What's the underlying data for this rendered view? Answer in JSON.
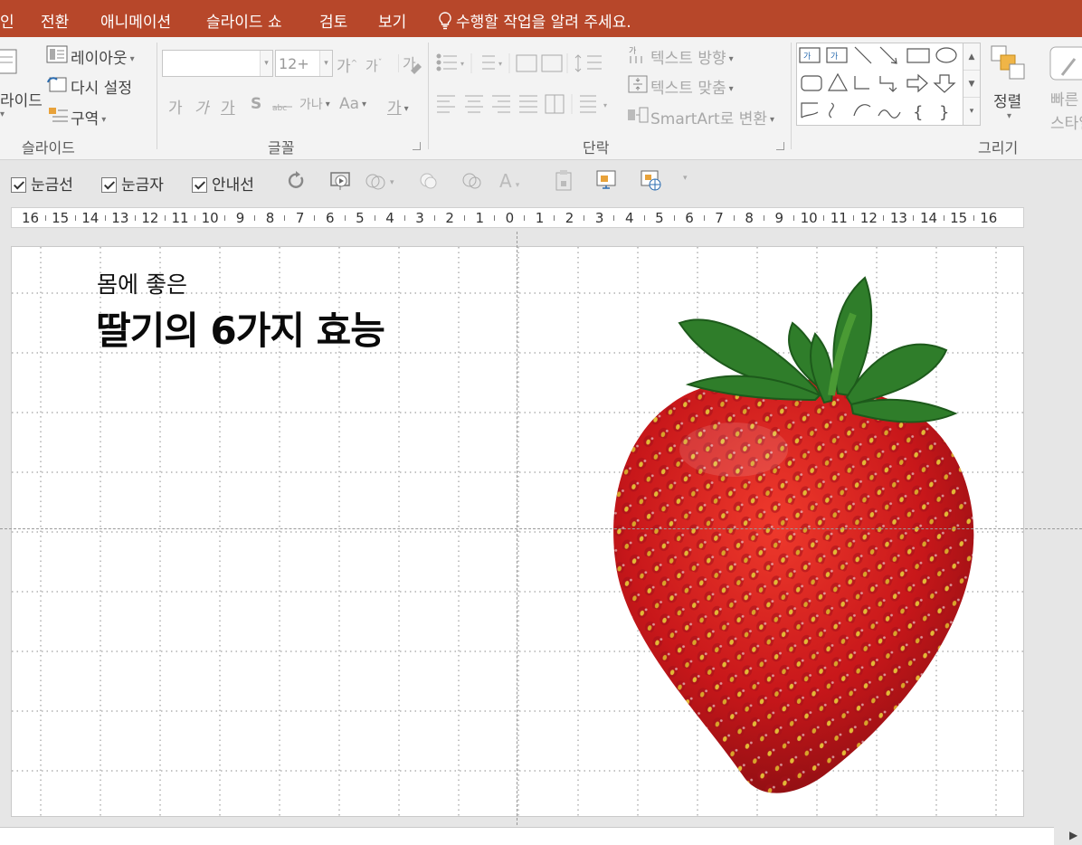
{
  "tabs": [
    "인",
    "전환",
    "애니메이션",
    "슬라이드 쇼",
    "검토",
    "보기"
  ],
  "tell_me": "수행할 작업을 알려 주세요.",
  "ribbon": {
    "slides": {
      "new_slide": "라이드",
      "layout": "레이아웃",
      "reset": "다시 설정",
      "section": "구역",
      "label": "슬라이드"
    },
    "font": {
      "size": "12+",
      "grow": "가",
      "shrink": "가",
      "bold": "가",
      "italic": "가",
      "underline": "가",
      "strike": "S",
      "spacing": "가나",
      "case": "Aa",
      "color": "가",
      "label": "글꼴"
    },
    "paragraph": {
      "text_direction": "텍스트 방향",
      "align_text": "텍스트 맞춤",
      "smartart": "SmartArt로 변환",
      "label": "단락"
    },
    "drawing": {
      "arrange": "정렬",
      "quick_styles": "빠른 스타일",
      "label": "그리기"
    }
  },
  "view_options": {
    "gridlines": "눈금선",
    "ruler": "눈금자",
    "guides": "안내선"
  },
  "ruler_labels": [
    "16",
    "15",
    "14",
    "13",
    "12",
    "11",
    "10",
    "9",
    "8",
    "7",
    "6",
    "5",
    "4",
    "3",
    "2",
    "1",
    "0",
    "1",
    "2",
    "3",
    "4",
    "5",
    "6",
    "7",
    "8",
    "9",
    "10",
    "11",
    "12",
    "13",
    "14",
    "15",
    "16"
  ],
  "slide": {
    "subtitle": "몸에 좋은",
    "title": "딸기의 6가지 효능"
  },
  "colors": {
    "accent": "#B7472A",
    "berry": "#C8171A",
    "leaf": "#2F7D2A"
  }
}
